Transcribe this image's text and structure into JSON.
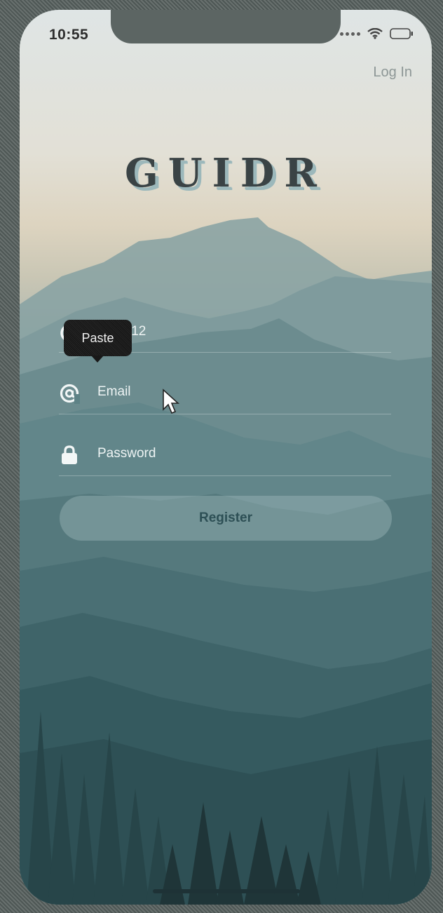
{
  "status_bar": {
    "time": "10:55"
  },
  "header": {
    "login_link": "Log In"
  },
  "brand": {
    "logo_text": "GUIDR"
  },
  "form": {
    "username": {
      "value": "Cole112",
      "icon": "user-icon"
    },
    "email": {
      "placeholder": "Email",
      "icon": "at-sign-icon"
    },
    "password": {
      "placeholder": "Password",
      "icon": "lock-icon"
    },
    "register_label": "Register"
  },
  "context_menu": {
    "paste_label": "Paste"
  },
  "colors": {
    "button_text": "#2d4f55",
    "logo": "#3a4345",
    "logo_shadow": "#9cb8bb"
  }
}
